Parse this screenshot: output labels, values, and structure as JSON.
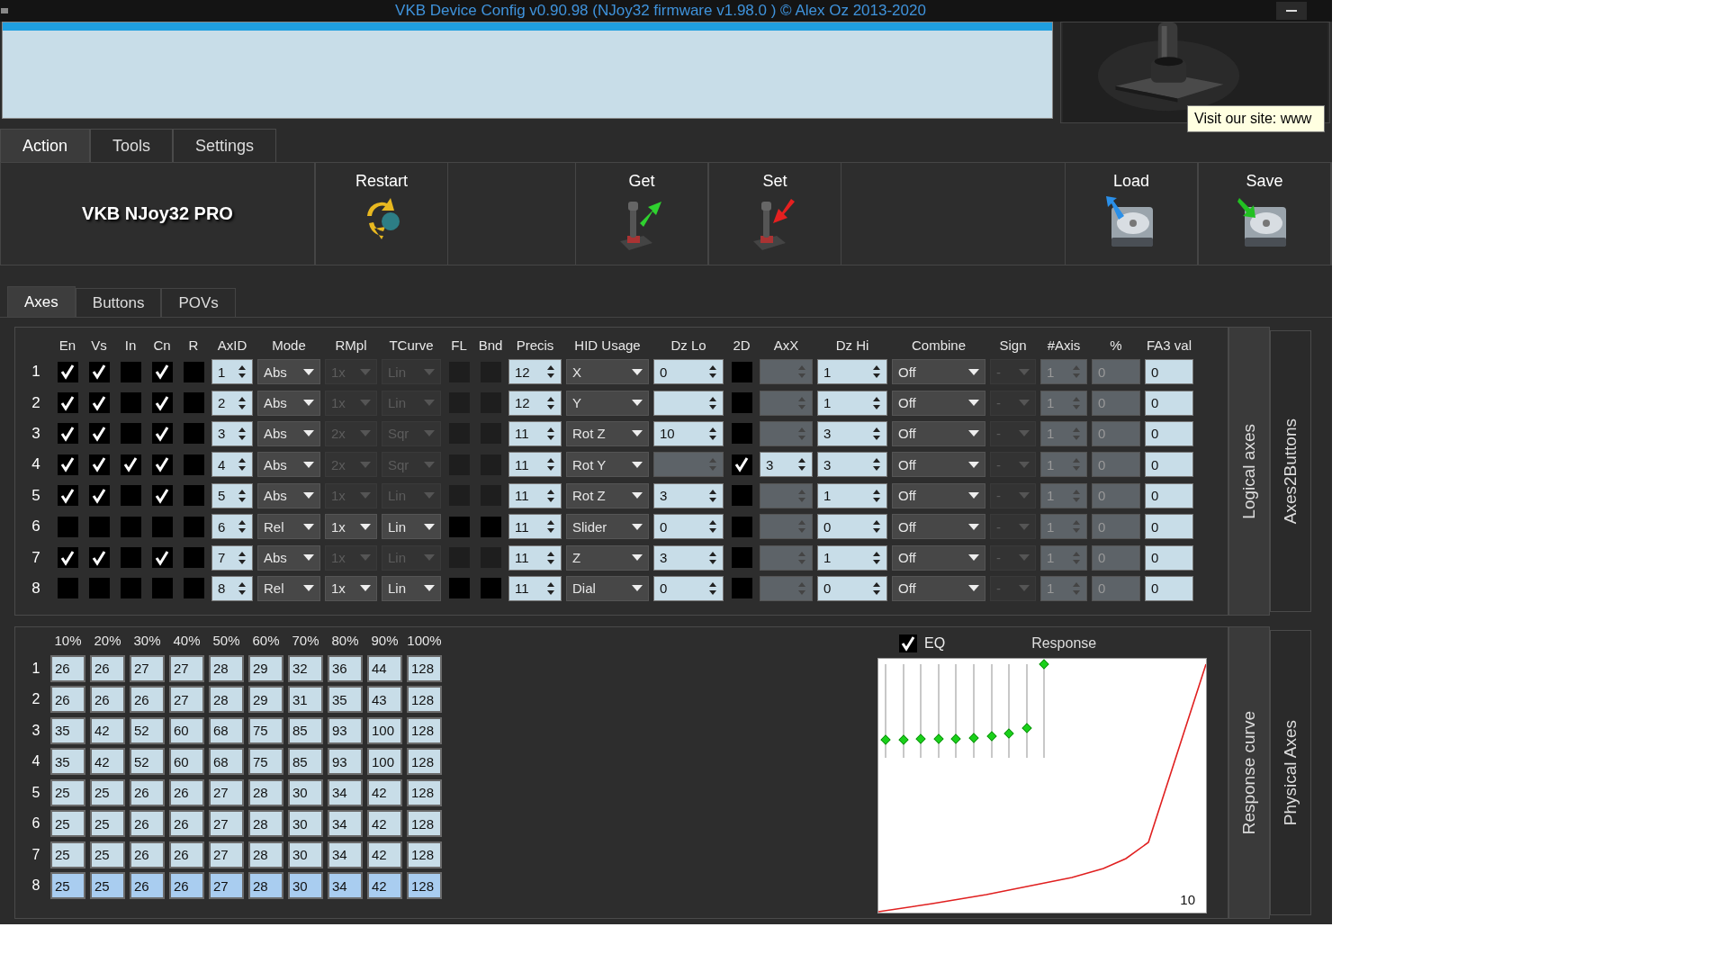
{
  "window": {
    "title": "VKB Device Config v0.90.98 (NJoy32 firmware v1.98.0  ) © Alex Oz 2013-2020"
  },
  "tooltip": "Visit our site: www",
  "main_tabs": [
    {
      "label": "Action",
      "selected": true
    },
    {
      "label": "Tools",
      "selected": false
    },
    {
      "label": "Settings",
      "selected": false
    }
  ],
  "toolbar": {
    "device_name": "VKB NJoy32 PRO",
    "buttons": [
      {
        "label": "Restart",
        "kind": "restart"
      },
      {
        "label": "Get",
        "kind": "get"
      },
      {
        "label": "Set",
        "kind": "set"
      },
      {
        "label": "Load",
        "kind": "load"
      },
      {
        "label": "Save",
        "kind": "save"
      }
    ]
  },
  "sub_tabs": [
    {
      "label": "Axes",
      "selected": true
    },
    {
      "label": "Buttons",
      "selected": false
    },
    {
      "label": "POVs",
      "selected": false
    }
  ],
  "axes": {
    "columns": [
      "En",
      "Vs",
      "In",
      "Cn",
      "R",
      "AxID",
      "Mode",
      "RMpl",
      "TCurve",
      "FL",
      "Bnd",
      "Precis",
      "HID Usage",
      "Dz Lo",
      "2D",
      "AxX",
      "Dz Hi",
      "Combine",
      "Sign",
      "#Axis",
      "%",
      "FA3 val"
    ],
    "rows": [
      {
        "num": "1",
        "en": true,
        "vs": true,
        "in": false,
        "cn": true,
        "r": false,
        "axid": "1",
        "mode": "Abs",
        "rmpl": "1x",
        "tcurve": "Lin",
        "scaling_disabled": true,
        "fl": false,
        "bnd": false,
        "precis": "12",
        "hid": "X",
        "dz_lo": "0",
        "dz_lo_disabled": false,
        "two_d": false,
        "axx_disabled": true,
        "dz_hi": "1",
        "combine": "Off",
        "sign": "-",
        "n_axis": "1",
        "pct": "0",
        "combine_params_disabled": true,
        "fa3": "0"
      },
      {
        "num": "2",
        "en": true,
        "vs": true,
        "in": false,
        "cn": true,
        "r": false,
        "axid": "2",
        "mode": "Abs",
        "rmpl": "1x",
        "tcurve": "Lin",
        "scaling_disabled": true,
        "fl": false,
        "bnd": false,
        "precis": "12",
        "hid": "Y",
        "dz_lo_disabled": false,
        "two_d": false,
        "axx_disabled": true,
        "dz_hi": "1",
        "combine": "Off",
        "sign": "-",
        "n_axis": "1",
        "pct": "0",
        "combine_params_disabled": true,
        "fa3": "0"
      },
      {
        "num": "3",
        "en": true,
        "vs": true,
        "in": false,
        "cn": true,
        "r": false,
        "axid": "3",
        "mode": "Abs",
        "rmpl": "2x",
        "tcurve": "Sqr",
        "scaling_disabled": true,
        "fl": false,
        "bnd": false,
        "precis": "11",
        "hid": "Rot Z",
        "dz_lo": "10",
        "dz_lo_disabled": false,
        "two_d": false,
        "axx_disabled": true,
        "dz_hi": "3",
        "combine": "Off",
        "sign": "-",
        "n_axis": "1",
        "pct": "0",
        "combine_params_disabled": true,
        "fa3": "0"
      },
      {
        "num": "4",
        "en": true,
        "vs": true,
        "in": true,
        "cn": true,
        "r": false,
        "axid": "4",
        "mode": "Abs",
        "rmpl": "2x",
        "tcurve": "Sqr",
        "scaling_disabled": true,
        "fl": false,
        "bnd": false,
        "precis": "11",
        "hid": "Rot Y",
        "dz_lo_disabled": true,
        "two_d": true,
        "axx": "3",
        "axx_disabled": false,
        "dz_hi": "3",
        "combine": "Off",
        "sign": "-",
        "n_axis": "1",
        "pct": "0",
        "combine_params_disabled": true,
        "fa3": "0"
      },
      {
        "num": "5",
        "en": true,
        "vs": true,
        "in": false,
        "cn": true,
        "r": false,
        "axid": "5",
        "mode": "Abs",
        "rmpl": "1x",
        "tcurve": "Lin",
        "scaling_disabled": true,
        "fl": false,
        "bnd": false,
        "precis": "11",
        "hid": "Rot Z",
        "dz_lo": "3",
        "dz_lo_disabled": false,
        "two_d": false,
        "axx_disabled": true,
        "dz_hi": "1",
        "combine": "Off",
        "sign": "-",
        "n_axis": "1",
        "pct": "0",
        "combine_params_disabled": true,
        "fa3": "0"
      },
      {
        "num": "6",
        "en": false,
        "vs": false,
        "in": false,
        "cn": false,
        "r": false,
        "axid": "6",
        "mode": "Rel",
        "rmpl": "1x",
        "tcurve": "Lin",
        "scaling_disabled": false,
        "fl": false,
        "bnd": false,
        "precis": "11",
        "hid": "Slider",
        "dz_lo": "0",
        "dz_lo_disabled": false,
        "two_d": false,
        "axx_disabled": true,
        "dz_hi": "0",
        "combine": "Off",
        "sign": "-",
        "n_axis": "1",
        "pct": "0",
        "combine_params_disabled": true,
        "fa3": "0"
      },
      {
        "num": "7",
        "en": true,
        "vs": true,
        "in": false,
        "cn": true,
        "r": false,
        "axid": "7",
        "mode": "Abs",
        "rmpl": "1x",
        "tcurve": "Lin",
        "scaling_disabled": true,
        "fl": false,
        "bnd": false,
        "precis": "11",
        "hid": "Z",
        "dz_lo": "3",
        "dz_lo_disabled": false,
        "two_d": false,
        "axx_disabled": true,
        "dz_hi": "1",
        "combine": "Off",
        "sign": "-",
        "n_axis": "1",
        "pct": "0",
        "combine_params_disabled": true,
        "fa3": "0"
      },
      {
        "num": "8",
        "en": false,
        "vs": false,
        "in": false,
        "cn": false,
        "r": false,
        "axid": "8",
        "mode": "Rel",
        "rmpl": "1x",
        "tcurve": "Lin",
        "scaling_disabled": false,
        "fl": false,
        "bnd": false,
        "precis": "11",
        "hid": "Dial",
        "dz_lo": "0",
        "dz_lo_disabled": false,
        "two_d": false,
        "axx_disabled": true,
        "dz_hi": "0",
        "combine": "Off",
        "sign": "-",
        "n_axis": "1",
        "pct": "0",
        "combine_params_disabled": true,
        "fa3": "0"
      }
    ]
  },
  "axes_side_tabs": [
    {
      "label": "Logical axes",
      "selected": true
    },
    {
      "label": "Axes2Buttons",
      "selected": false
    }
  ],
  "response": {
    "columns": [
      "10%",
      "20%",
      "30%",
      "40%",
      "50%",
      "60%",
      "70%",
      "80%",
      "90%",
      "100%"
    ],
    "rows": [
      {
        "num": "1",
        "selected": false,
        "values": [
          "26",
          "26",
          "27",
          "27",
          "28",
          "29",
          "32",
          "36",
          "44",
          "128"
        ]
      },
      {
        "num": "2",
        "selected": false,
        "values": [
          "26",
          "26",
          "26",
          "27",
          "28",
          "29",
          "31",
          "35",
          "43",
          "128"
        ]
      },
      {
        "num": "3",
        "selected": false,
        "values": [
          "35",
          "42",
          "52",
          "60",
          "68",
          "75",
          "85",
          "93",
          "100",
          "128"
        ]
      },
      {
        "num": "4",
        "selected": false,
        "values": [
          "35",
          "42",
          "52",
          "60",
          "68",
          "75",
          "85",
          "93",
          "100",
          "128"
        ]
      },
      {
        "num": "5",
        "selected": false,
        "values": [
          "25",
          "25",
          "26",
          "26",
          "27",
          "28",
          "30",
          "34",
          "42",
          "128"
        ]
      },
      {
        "num": "6",
        "selected": false,
        "values": [
          "25",
          "25",
          "26",
          "26",
          "27",
          "28",
          "30",
          "34",
          "42",
          "128"
        ]
      },
      {
        "num": "7",
        "selected": false,
        "values": [
          "25",
          "25",
          "26",
          "26",
          "27",
          "28",
          "30",
          "34",
          "42",
          "128"
        ]
      },
      {
        "num": "8",
        "selected": true,
        "values": [
          "25",
          "25",
          "26",
          "26",
          "27",
          "28",
          "30",
          "34",
          "42",
          "128"
        ]
      }
    ],
    "eq": {
      "label": "EQ",
      "checked": true
    },
    "chart_title": "Response",
    "eq_sliders": [
      {
        "level": 0.19
      },
      {
        "level": 0.19
      },
      {
        "level": 0.2
      },
      {
        "level": 0.2
      },
      {
        "level": 0.2
      },
      {
        "level": 0.21
      },
      {
        "level": 0.23
      },
      {
        "level": 0.26
      },
      {
        "level": 0.32
      },
      {
        "level": 1
      }
    ],
    "curve_label": "10"
  },
  "response_side_tabs": [
    {
      "label": "Response curve",
      "selected": true
    },
    {
      "label": "Physical Axes",
      "selected": false
    }
  ]
}
